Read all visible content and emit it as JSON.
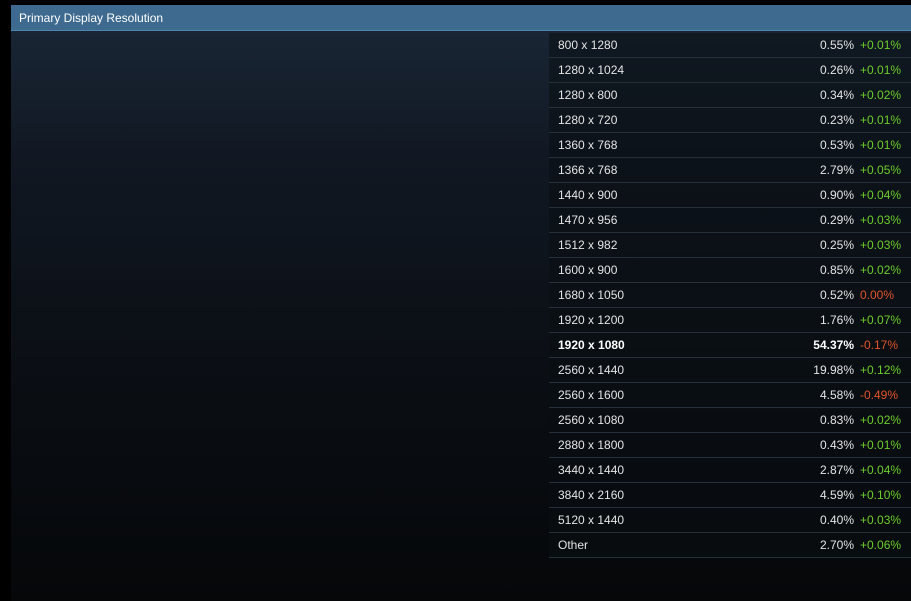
{
  "header": {
    "title": "Primary Display Resolution"
  },
  "colors": {
    "header_bg": "#3d6a8e",
    "positive": "#6ccc2d",
    "negative": "#e0542a"
  },
  "rows": [
    {
      "resolution": "800 x 1280",
      "percent": "0.55%",
      "change": "+0.01%",
      "trend": "pos"
    },
    {
      "resolution": "1280 x 1024",
      "percent": "0.26%",
      "change": "+0.01%",
      "trend": "pos"
    },
    {
      "resolution": "1280 x 800",
      "percent": "0.34%",
      "change": "+0.02%",
      "trend": "pos"
    },
    {
      "resolution": "1280 x 720",
      "percent": "0.23%",
      "change": "+0.01%",
      "trend": "pos"
    },
    {
      "resolution": "1360 x 768",
      "percent": "0.53%",
      "change": "+0.01%",
      "trend": "pos"
    },
    {
      "resolution": "1366 x 768",
      "percent": "2.79%",
      "change": "+0.05%",
      "trend": "pos"
    },
    {
      "resolution": "1440 x 900",
      "percent": "0.90%",
      "change": "+0.04%",
      "trend": "pos"
    },
    {
      "resolution": "1470 x 956",
      "percent": "0.29%",
      "change": "+0.03%",
      "trend": "pos"
    },
    {
      "resolution": "1512 x 982",
      "percent": "0.25%",
      "change": "+0.03%",
      "trend": "pos"
    },
    {
      "resolution": "1600 x 900",
      "percent": "0.85%",
      "change": "+0.02%",
      "trend": "pos"
    },
    {
      "resolution": "1680 x 1050",
      "percent": "0.52%",
      "change": "0.00%",
      "trend": "neg"
    },
    {
      "resolution": "1920 x 1200",
      "percent": "1.76%",
      "change": "+0.07%",
      "trend": "pos"
    },
    {
      "resolution": "1920 x 1080",
      "percent": "54.37%",
      "change": "-0.17%",
      "trend": "neg",
      "highlight": true
    },
    {
      "resolution": "2560 x 1440",
      "percent": "19.98%",
      "change": "+0.12%",
      "trend": "pos"
    },
    {
      "resolution": "2560 x 1600",
      "percent": "4.58%",
      "change": "-0.49%",
      "trend": "neg"
    },
    {
      "resolution": "2560 x 1080",
      "percent": "0.83%",
      "change": "+0.02%",
      "trend": "pos"
    },
    {
      "resolution": "2880 x 1800",
      "percent": "0.43%",
      "change": "+0.01%",
      "trend": "pos"
    },
    {
      "resolution": "3440 x 1440",
      "percent": "2.87%",
      "change": "+0.04%",
      "trend": "pos"
    },
    {
      "resolution": "3840 x 2160",
      "percent": "4.59%",
      "change": "+0.10%",
      "trend": "pos"
    },
    {
      "resolution": "5120 x 1440",
      "percent": "0.40%",
      "change": "+0.03%",
      "trend": "pos"
    },
    {
      "resolution": "Other",
      "percent": "2.70%",
      "change": "+0.06%",
      "trend": "pos"
    }
  ]
}
